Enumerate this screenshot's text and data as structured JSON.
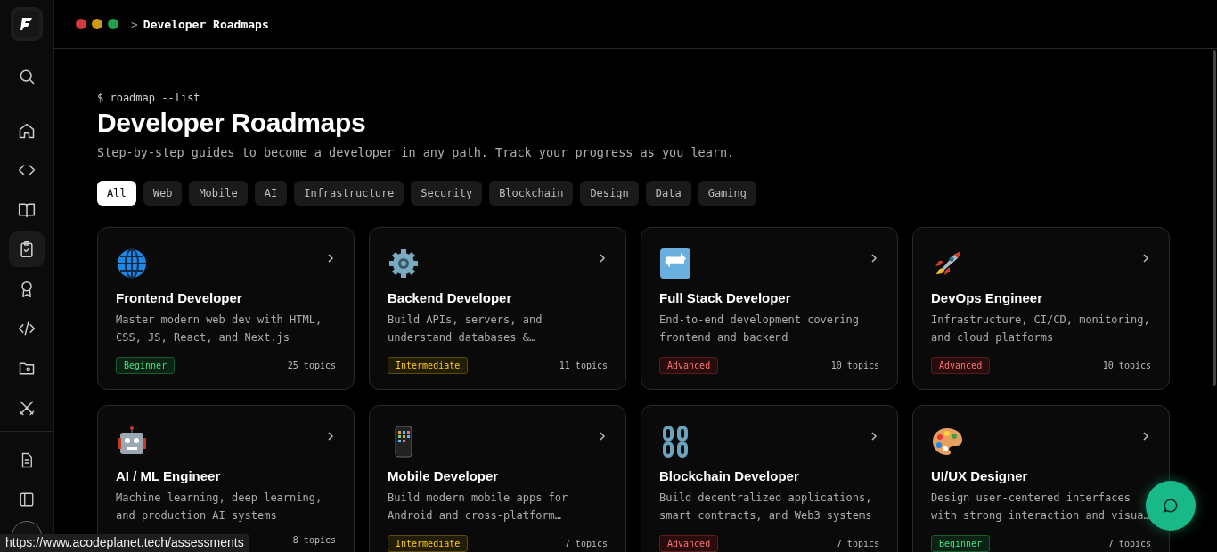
{
  "header": {
    "separator": ">",
    "title": "Developer Roadmaps"
  },
  "sidebar": {
    "items": [
      {
        "selected": false
      },
      {
        "selected": false
      },
      {
        "selected": false
      },
      {
        "selected": false
      },
      {
        "selected": true
      },
      {
        "selected": false
      },
      {
        "selected": false
      },
      {
        "selected": false
      },
      {
        "selected": false
      }
    ]
  },
  "page": {
    "command": "$ roadmap --list",
    "title": "Developer Roadmaps",
    "subtitle": "Step-by-step guides to become a developer in any path. Track your progress as you learn."
  },
  "filters": [
    {
      "label": "All",
      "selected": true
    },
    {
      "label": "Web",
      "selected": false
    },
    {
      "label": "Mobile",
      "selected": false
    },
    {
      "label": "AI",
      "selected": false
    },
    {
      "label": "Infrastructure",
      "selected": false
    },
    {
      "label": "Security",
      "selected": false
    },
    {
      "label": "Blockchain",
      "selected": false
    },
    {
      "label": "Design",
      "selected": false
    },
    {
      "label": "Data",
      "selected": false
    },
    {
      "label": "Gaming",
      "selected": false
    }
  ],
  "roadmaps": [
    {
      "title": "Frontend Developer",
      "description": "Master modern web dev with HTML, CSS, JS, React, and Next.js",
      "badge": {
        "text": "Beginner",
        "kind": "beginner"
      },
      "topics": "25 topics"
    },
    {
      "title": "Backend Developer",
      "description": "Build APIs, servers, and understand databases &…",
      "badge": {
        "text": "Intermediate",
        "kind": "intermediate"
      },
      "topics": "11 topics"
    },
    {
      "title": "Full Stack Developer",
      "description": "End-to-end development covering frontend and backend",
      "badge": {
        "text": "Advanced",
        "kind": "advanced"
      },
      "topics": "10 topics"
    },
    {
      "title": "DevOps Engineer",
      "description": "Infrastructure, CI/CD, monitoring, and cloud platforms",
      "badge": {
        "text": "Advanced",
        "kind": "advanced"
      },
      "topics": "10 topics"
    },
    {
      "title": "AI / ML Engineer",
      "description": "Machine learning, deep learning, and production AI systems",
      "topics": "8 topics"
    },
    {
      "title": "Mobile Developer",
      "description": "Build modern mobile apps for Android and cross-platform…",
      "badge": {
        "text": "Intermediate",
        "kind": "intermediate"
      },
      "topics": "7 topics"
    },
    {
      "title": "Blockchain Developer",
      "description": "Build decentralized applications, smart contracts, and Web3 systems",
      "badge": {
        "text": "Advanced",
        "kind": "advanced"
      },
      "topics": "7 topics"
    },
    {
      "title": "UI/UX Designer",
      "description": "Design user-centered interfaces with strong interaction and visua…",
      "badge": {
        "text": "Beginner",
        "kind": "beginner"
      },
      "topics": "7 topics"
    }
  ],
  "status_url": "https://www.acodeplanet.tech/assessments"
}
